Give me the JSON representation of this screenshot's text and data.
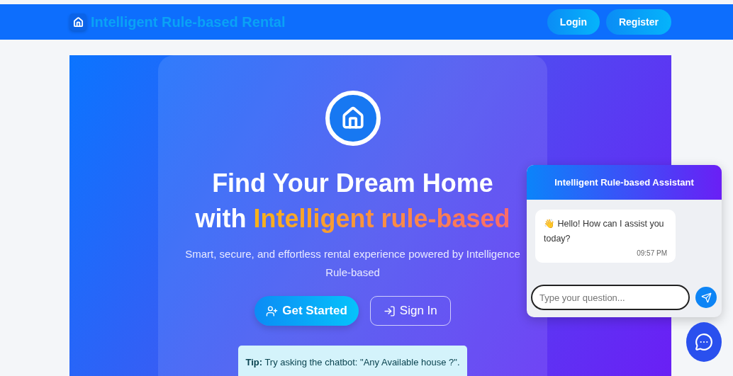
{
  "navbar": {
    "brand": "Intelligent Rule-based Rental",
    "buttons": [
      "Login",
      "Register"
    ]
  },
  "hero": {
    "headline": "Find Your Dream Home",
    "headline_prefix": "with",
    "headline_highlight": "Intelligent rule-based",
    "subtitle": "Smart, secure, and effortless rental experience powered by Intelligence Rule-based",
    "primary_button": "Get Started",
    "secondary_button": "Sign In",
    "tip": "**Tip:** Try asking the chatbot: \"Any Available house ?\"."
  },
  "chat": {
    "title": "Intelligent Rule-based Assistant",
    "messages": [
      {
        "text": "👋 Hello! How can I assist you today?",
        "time": "09:57 PM"
      }
    ],
    "input": {
      "placeholder": "Type your question..."
    }
  }
}
